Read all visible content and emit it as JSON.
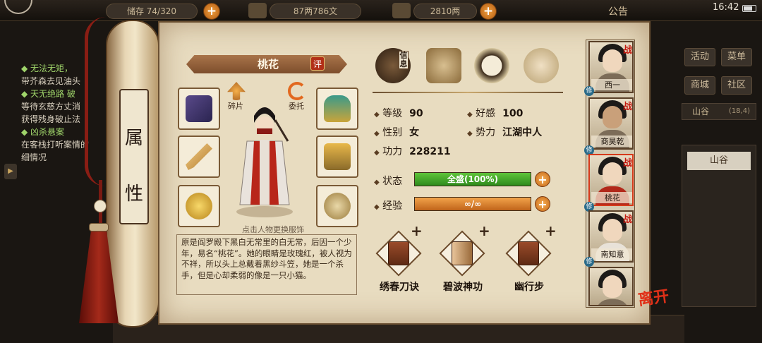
{
  "topbar": {
    "bag": "储存 74/320",
    "money": "87两786文",
    "gold": "2810两",
    "notice": "公告",
    "time": "16:42"
  },
  "quests": [
    {
      "title": "无法无矩，",
      "desc": [
        "带芥森去见油头"
      ]
    },
    {
      "title": "天无绝路 破",
      "desc": [
        "等待玄慈方丈消",
        "获得残身破止法"
      ]
    },
    {
      "title": "凶杀悬案",
      "desc": [
        "在客栈打听案情的",
        "细情况"
      ]
    }
  ],
  "rightmenu": {
    "activity": "活动",
    "menu": "菜单",
    "shop": "商城",
    "community": "社区",
    "location": "山谷",
    "coord": "(18,4)",
    "location_item": "山谷"
  },
  "scroll": {
    "title_chars": [
      "属",
      "性"
    ]
  },
  "character": {
    "name": "桃花",
    "eval": "评",
    "fragment_label": "碎片",
    "entrust_label": "委托",
    "hint": "点击人物更换服饰",
    "description": "原是阎罗殿下黑白无常里的白无常，后因一个少年，易名“桃花”。她的眼睛是玫瑰红，被人视为不祥，所以头上总戴着黑纱斗笠，她是一个杀手，但是心却柔弱的像是一只小猫。"
  },
  "tabs": {
    "info_label": "信息",
    "icons": [
      "hat-icon",
      "scroll-book-icon",
      "bagua-icon",
      "muscle-figure-icon"
    ]
  },
  "stats": {
    "level_label": "等级",
    "level": "90",
    "favor_label": "好感",
    "favor": "100",
    "gender_label": "性别",
    "gender": "女",
    "faction_label": "势力",
    "faction": "江湖中人",
    "power_label": "功力",
    "power": "228211",
    "status_label": "状态",
    "status": "全盛(100%)",
    "status_fill": 1.0,
    "exp_label": "经验",
    "exp": "∞/∞",
    "exp_fill": 1.0
  },
  "skills": [
    "绣春刀诀",
    "碧波神功",
    "幽行步"
  ],
  "roster": [
    {
      "name": "西一",
      "war": "战",
      "badge": "修"
    },
    {
      "name": "商昊乾",
      "war": "战",
      "badge": "修"
    },
    {
      "name": "桃花",
      "war": "战",
      "badge": "修"
    },
    {
      "name": "南知意",
      "war": "战",
      "badge": "修"
    },
    {
      "name": "",
      "war": "",
      "badge": "修"
    }
  ],
  "leave": "离开",
  "colors": {
    "parchment": "#e8dcc0",
    "hp_bar": "#4aa82c",
    "exp_bar": "#e08a34",
    "accent_red": "#c5180e"
  }
}
